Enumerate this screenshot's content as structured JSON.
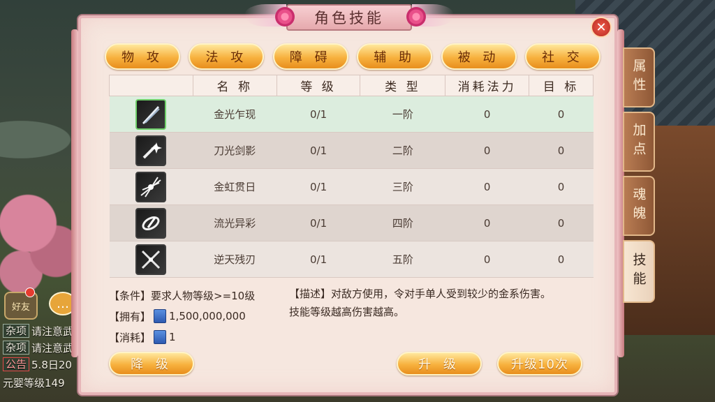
{
  "window": {
    "title": "角色技能"
  },
  "category_tabs": [
    "物 攻",
    "法 攻",
    "障 碍",
    "辅 助",
    "被 动",
    "社 交"
  ],
  "table": {
    "headers": [
      "",
      "名 称",
      "等 级",
      "类 型",
      "消耗法力",
      "目 标"
    ],
    "rows": [
      {
        "name": "金光乍现",
        "level": "0/1",
        "type": "一阶",
        "mana": "0",
        "target": "0",
        "icon": "sword-slash-icon"
      },
      {
        "name": "刀光剑影",
        "level": "0/1",
        "type": "二阶",
        "mana": "0",
        "target": "0",
        "icon": "blade-sparkle-icon"
      },
      {
        "name": "金虹贯日",
        "level": "0/1",
        "type": "三阶",
        "mana": "0",
        "target": "0",
        "icon": "light-burst-icon"
      },
      {
        "name": "流光异彩",
        "level": "0/1",
        "type": "四阶",
        "mana": "0",
        "target": "0",
        "icon": "spin-blade-icon"
      },
      {
        "name": "逆天残刃",
        "level": "0/1",
        "type": "五阶",
        "mana": "0",
        "target": "0",
        "icon": "cross-blade-icon"
      }
    ]
  },
  "info": {
    "condition": "【条件】要求人物等级>=10级",
    "own_label": "【拥有】",
    "own_value": "1,500,000,000",
    "cost_label": "【消耗】",
    "cost_value": "1",
    "description_line1": "【描述】对敌方使用，令对手单人受到较少的金系伤害。",
    "description_line2": "技能等级越高伤害越高。"
  },
  "buttons": {
    "downgrade": "降 级",
    "upgrade": "升 级",
    "upgrade10": "升级10次"
  },
  "side_tabs": [
    "属性",
    "加点",
    "魂魄",
    "技能"
  ],
  "chat": {
    "friend_button": "好友",
    "lines": [
      {
        "tag": "杂项",
        "text": "请注意武"
      },
      {
        "tag": "杂项",
        "text": "请注意武"
      },
      {
        "tag": "公告",
        "text": "5.8日20"
      }
    ],
    "last_line": "元婴等级149"
  }
}
